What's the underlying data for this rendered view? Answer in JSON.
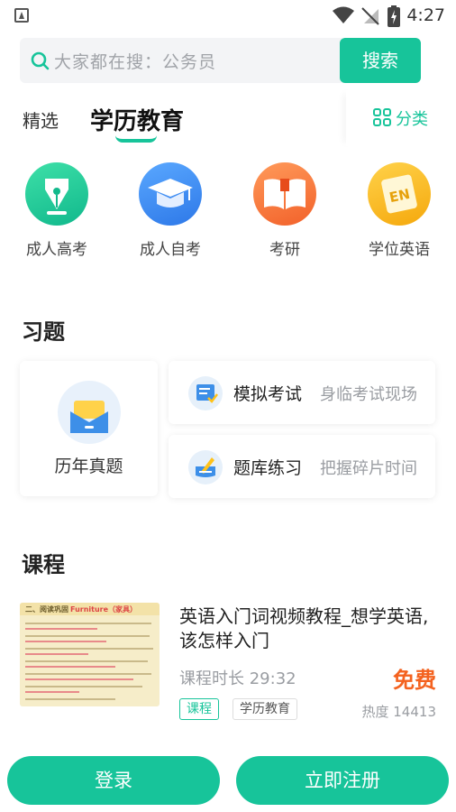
{
  "status_bar": {
    "time": "4:27",
    "icons": [
      "app-icon",
      "wifi-icon",
      "no-signal-icon",
      "battery-icon"
    ]
  },
  "search": {
    "placeholder": "大家都在搜：公务员",
    "button_label": "搜索"
  },
  "tabs": [
    {
      "label": "精选",
      "active": false
    },
    {
      "label": "学历教育",
      "active": true
    }
  ],
  "category_button": {
    "label": "分类"
  },
  "categories": [
    {
      "label": "成人高考",
      "icon": "fountain-pen-icon"
    },
    {
      "label": "成人自考",
      "icon": "graduation-cap-icon"
    },
    {
      "label": "考研",
      "icon": "open-book-icon"
    },
    {
      "label": "学位英语",
      "icon": "en-badge-icon"
    }
  ],
  "exercises": {
    "title": "习题",
    "past_papers": {
      "label": "历年真题"
    },
    "mock_exam": {
      "title": "模拟考试",
      "subtitle": "身临考试现场"
    },
    "question_bank": {
      "title": "题库练习",
      "subtitle": "把握碎片时间"
    }
  },
  "courses": {
    "title": "课程",
    "items": [
      {
        "title": "英语入门词视频教程_想学英语,该怎样入门",
        "duration": "课程时长 29:32",
        "price": "免费",
        "tags": [
          "课程",
          "学历教育"
        ],
        "heat": "热度 14413"
      }
    ]
  },
  "bottom_bar": {
    "login_label": "登录",
    "register_label": "立即注册"
  },
  "colors": {
    "accent": "#17c49a",
    "price": "#f4621f"
  }
}
